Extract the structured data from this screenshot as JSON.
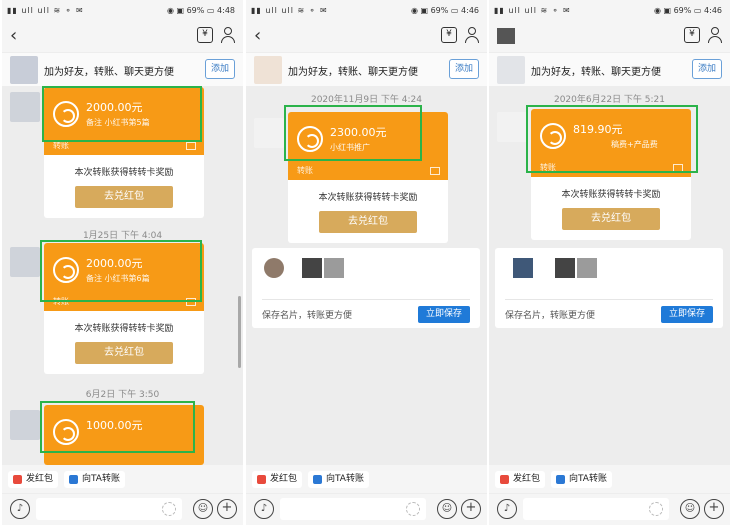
{
  "status": {
    "time1": "4:48",
    "time2": "4:46",
    "time3": "4:46",
    "battery": "69%"
  },
  "header": {
    "add_friend_text": "加为好友，转账、聊天更方便",
    "add_button": "添加",
    "back_icon": "chevron-left-icon",
    "yuan_icon": "yuan-icon",
    "profile_icon": "person-icon"
  },
  "transfer": {
    "reward_text": "本次转账获得转转卡奖励",
    "redeem_button": "去兑红包",
    "label": "转账"
  },
  "panel1": {
    "cards": [
      {
        "amount": "2000.00元",
        "note": "备注  小红书第5篇"
      },
      {
        "time": "1月25日 下午 4:04",
        "amount": "2000.00元",
        "note": "备注  小红书第6篇"
      },
      {
        "time": "6月2日 下午 3:50",
        "amount": "1000.00元",
        "note": ""
      }
    ]
  },
  "panel2": {
    "time": "2020年11月9日 下午 4:24",
    "amount": "2300.00元",
    "note": "小红书推广"
  },
  "panel3": {
    "time": "2020年6月22日 下午 5:21",
    "amount": "819.90元",
    "note": "稿费+产品费"
  },
  "namecard": {
    "label": "保存名片，转账更方便",
    "save_button": "立即保存"
  },
  "actions": {
    "red_packet": "发红包",
    "transfer": "向TA转账"
  },
  "colors": {
    "orange": "#f79a16",
    "gold": "#d7aa5c",
    "highlight": "#2bb34a",
    "blue": "#1f7ad8"
  }
}
